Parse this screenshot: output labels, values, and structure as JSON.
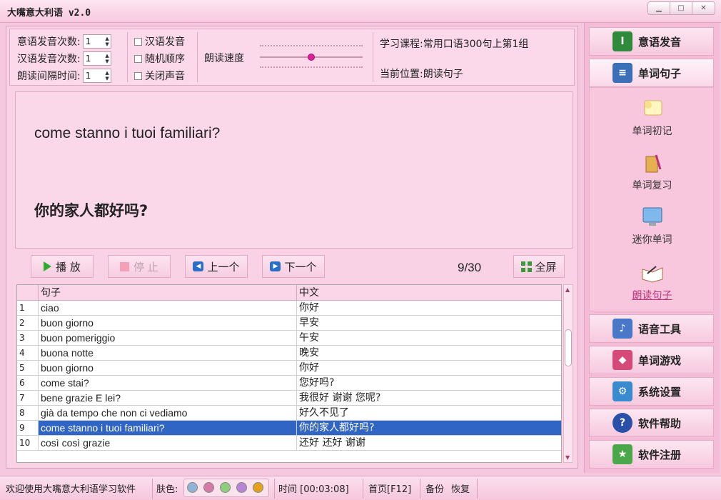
{
  "window": {
    "title": "大嘴意大利语 v2.0",
    "controls": [
      "▁",
      "□",
      "✕"
    ]
  },
  "options": {
    "it_repeat_label": "意语发音次数:",
    "it_repeat_value": "1",
    "cn_repeat_label": "汉语发音次数:",
    "cn_repeat_value": "1",
    "interval_label": "朗读间隔时间:",
    "interval_value": "1",
    "chk_cn": "汉语发音",
    "chk_random": "随机顺序",
    "chk_mute": "关闭声音",
    "speed_label": "朗读速度",
    "speed_level": 0.5,
    "course": "学习课程:常用口语300句上第1组",
    "position": "当前位置:朗读句子"
  },
  "display": {
    "italian": "come stanno i tuoi familiari?",
    "chinese": "你的家人都好吗?"
  },
  "controls": {
    "play": "播 放",
    "stop": "停 止",
    "prev": "上一个",
    "next": "下一个",
    "counter": "9/30",
    "fullscreen": "全屏"
  },
  "table": {
    "headers": [
      "句子",
      "中文"
    ],
    "rows": [
      {
        "num": "1",
        "it": "ciao",
        "cn": "你好"
      },
      {
        "num": "2",
        "it": "buon giorno",
        "cn": "早安"
      },
      {
        "num": "3",
        "it": "buon pomeriggio",
        "cn": "午安"
      },
      {
        "num": "4",
        "it": "buona notte",
        "cn": "晚安"
      },
      {
        "num": "5",
        "it": "buon giorno",
        "cn": "你好"
      },
      {
        "num": "6",
        "it": "come stai?",
        "cn": "您好吗?"
      },
      {
        "num": "7",
        "it": "bene grazie E lei?",
        "cn": "我很好 谢谢 您呢?"
      },
      {
        "num": "8",
        "it": "già da tempo che non ci vediamo",
        "cn": "好久不见了"
      },
      {
        "num": "9",
        "it": "come stanno i tuoi familiari?",
        "cn": "你的家人都好吗?"
      },
      {
        "num": "10",
        "it": "così così grazie",
        "cn": "还好 还好 谢谢"
      }
    ],
    "selected_row": 9
  },
  "nav": {
    "pronunciation": "意语发音",
    "words_sentences": "单词句子",
    "sub": {
      "first_learn": "单词初记",
      "review": "单词复习",
      "mini": "迷你单词",
      "read_sentence": "朗读句子"
    },
    "voice_tools": "语音工具",
    "word_games": "单词游戏",
    "settings": "系统设置",
    "help": "软件帮助",
    "register": "软件注册"
  },
  "status": {
    "welcome": "欢迎使用大嘴意大利语学习软件",
    "skin_label": "肤色:",
    "skin_colors": [
      "#8fb4d6",
      "#d67aa8",
      "#8fce7c",
      "#b685d6",
      "#e3a21a"
    ],
    "time": "时间 [00:03:08]",
    "home": "首页[F12]",
    "backup": "备份",
    "restore": "恢复"
  },
  "colors": {
    "accent": "#3165c5",
    "background": "#f6c8e0"
  }
}
